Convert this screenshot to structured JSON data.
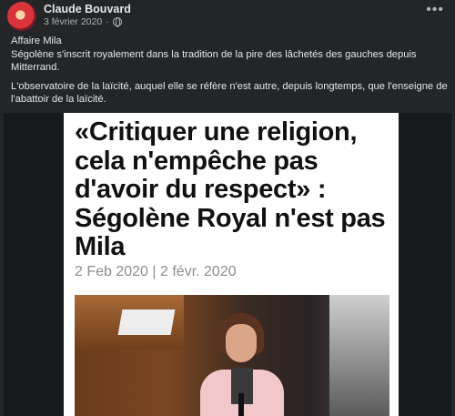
{
  "post": {
    "author": "Claude Bouvard",
    "date": "3 février 2020",
    "dot": "·",
    "more_label": "•••",
    "text_lines": [
      "Affaire Mila",
      "Ségolène  s'inscrit royalement dans la tradition de  la pire des lâchetés des gauches depuis Mitterrand.",
      "L'observatoire de la laïcité, auquel elle se réfère n'est autre, depuis longtemps, que l'enseigne de l'abattoir de la laïcité."
    ]
  },
  "article": {
    "headline": "«Critiquer une religion, cela n'empêche pas d'avoir du respect» : Ségolène Royal n'est pas Mila",
    "dateline": "2 Feb 2020 | 2 févr. 2020"
  },
  "colors": {
    "background": "#242526",
    "text": "#e4e6eb",
    "secondary": "#b0b3b8"
  }
}
